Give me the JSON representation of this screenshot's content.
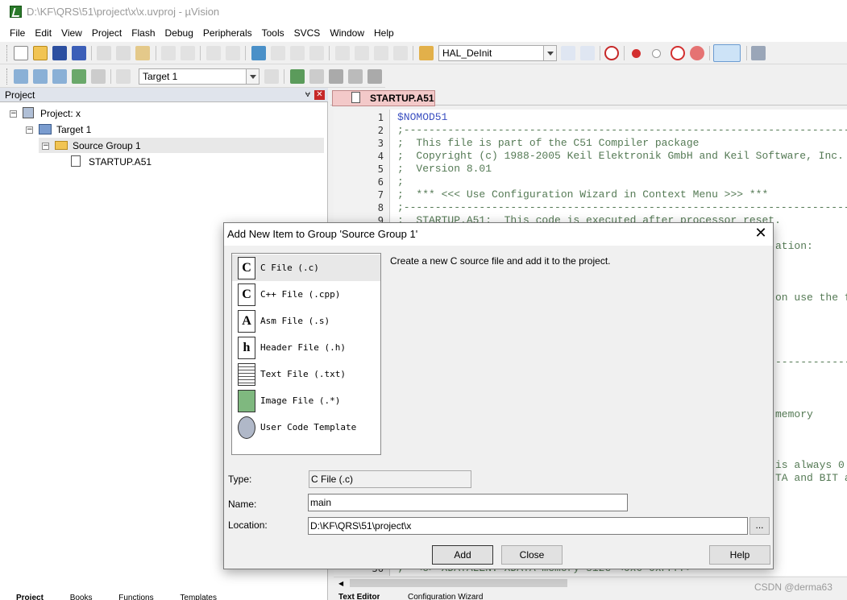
{
  "window": {
    "title": "D:\\KF\\QRS\\51\\project\\x\\x.uvproj - µVision"
  },
  "menu": [
    "File",
    "Edit",
    "View",
    "Project",
    "Flash",
    "Debug",
    "Peripherals",
    "Tools",
    "SVCS",
    "Window",
    "Help"
  ],
  "toolbar": {
    "function_combo": "HAL_DeInit",
    "target_combo": "Target 1"
  },
  "project_panel": {
    "title": "Project",
    "pin": "❤",
    "tree": {
      "project": "Project: x",
      "target": "Target 1",
      "group": "Source Group 1",
      "file": "STARTUP.A51"
    },
    "bottom_tabs": [
      "Project",
      "Books",
      "Functions",
      "Templates"
    ]
  },
  "editor": {
    "tab": "STARTUP.A51",
    "line_numbers": [
      "1",
      "2",
      "3",
      "4",
      "5",
      "6",
      "7",
      "8",
      "9",
      "36"
    ],
    "lines": [
      "$NOMOD51",
      ";------------------------------------------------------------------------------",
      ";  This file is part of the C51 Compiler package",
      ";  Copyright (c) 1988-2005 Keil Elektronik GmbH and Keil Software, Inc.",
      ";  Version 8.01",
      ";",
      ";  *** <<< Use Configuration Wizard in Context Menu >>> ***",
      ";------------------------------------------------------------------------------",
      ";  STARTUP.A51:  This code is executed after processor reset."
    ],
    "right_fragments": [
      "ation:",
      "on use the f",
      "-----------------",
      "memory",
      "is always 0",
      "TA and BIT a"
    ],
    "bottom_line": ";  <o> XDATALEN: XDATA memory size <0x0-0xFFFF>",
    "bottom_tabs": [
      "Text Editor",
      "Configuration Wizard"
    ]
  },
  "watermark": "CSDN @derma63",
  "dialog": {
    "title": "Add New Item to Group 'Source Group 1'",
    "close": "✕",
    "items": [
      {
        "label": "C File (.c)",
        "icon": "C"
      },
      {
        "label": "C++ File (.cpp)",
        "icon": "C"
      },
      {
        "label": "Asm File (.s)",
        "icon": "A"
      },
      {
        "label": "Header File (.h)",
        "icon": "h"
      },
      {
        "label": "Text File (.txt)",
        "icon": ""
      },
      {
        "label": "Image File (.*)",
        "icon": ""
      },
      {
        "label": "User Code Template",
        "icon": ""
      }
    ],
    "description": "Create a new C source file and add it to the project.",
    "type_label": "Type:",
    "type_value": "C File (.c)",
    "name_label": "Name:",
    "name_value": "main",
    "location_label": "Location:",
    "location_value": "D:\\KF\\QRS\\51\\project\\x",
    "browse": "...",
    "add": "Add",
    "close_btn": "Close",
    "help": "Help"
  }
}
